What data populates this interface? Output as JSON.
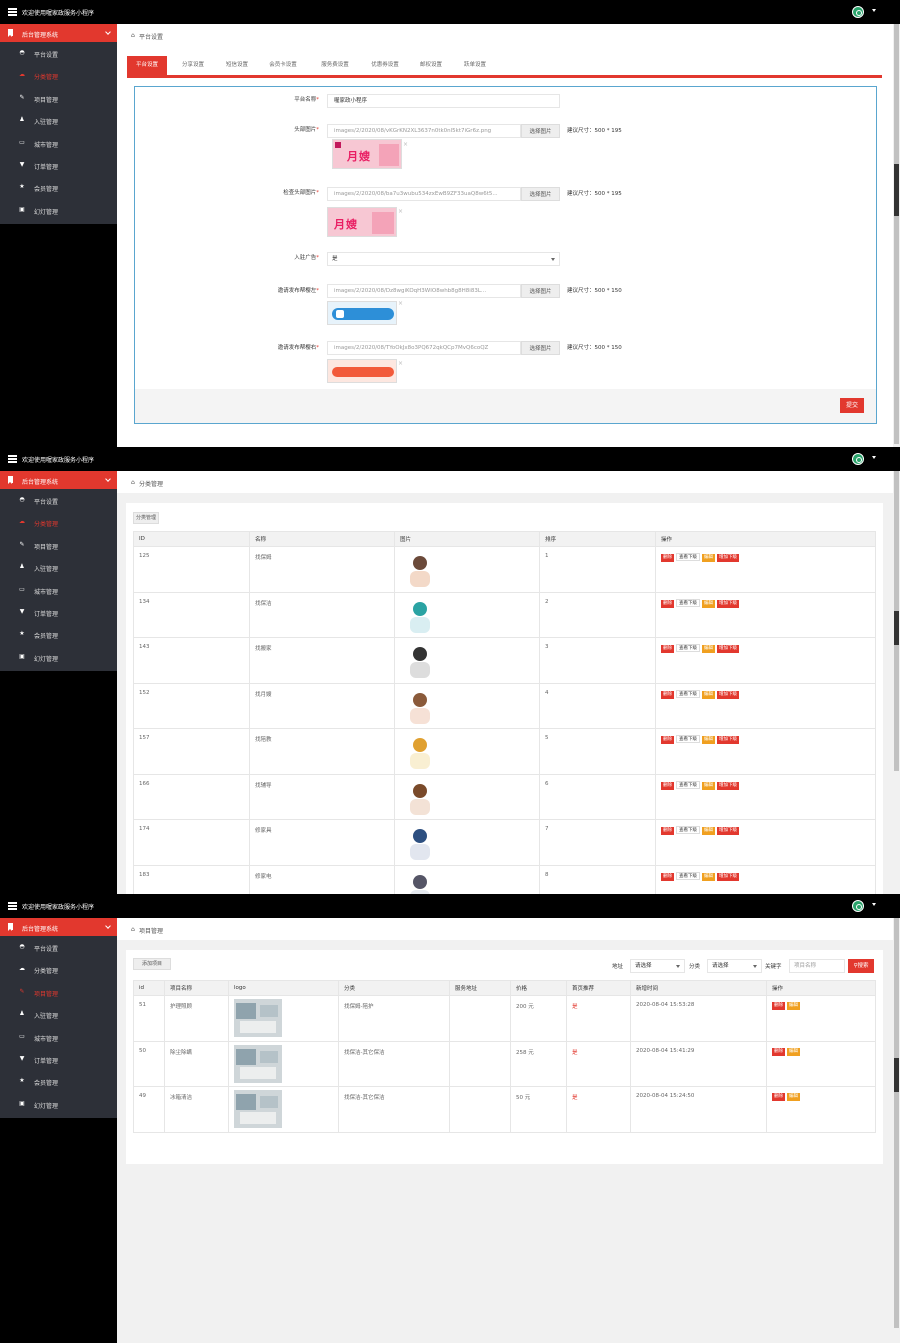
{
  "app": {
    "title": "欢迎使用喔家政服务小程序",
    "accent": "#e2382e",
    "sidebar_bg": "#2d3038"
  },
  "sidebar": {
    "head": "后台管理系统",
    "items": [
      {
        "label": "平台设置",
        "icon": "palette-icon"
      },
      {
        "label": "分类管理",
        "icon": "cloud-icon"
      },
      {
        "label": "项目管理",
        "icon": "pencil-icon"
      },
      {
        "label": "入驻管理",
        "icon": "user-icon"
      },
      {
        "label": "城市管理",
        "icon": "inbox-icon"
      },
      {
        "label": "订单管理",
        "icon": "filter-icon"
      },
      {
        "label": "会员管理",
        "icon": "star-icon"
      },
      {
        "label": "幻灯管理",
        "icon": "book-icon"
      }
    ]
  },
  "screen1": {
    "crumb": "平台设置",
    "tabs": [
      "平台设置",
      "分享设置",
      "短信设置",
      "会员卡设置",
      "服务费设置",
      "优惠券设置",
      "邮权设置",
      "跃单设置"
    ],
    "form": {
      "name_label": "平台名称",
      "name_value": "喔家政小程序",
      "head_label": "头部图片",
      "head_value": "images/2/2020/08/vKGrKN2XL3637n0tk0nl5kt7iGr6z.png",
      "banner_label": "检查头部图片",
      "banner_value": "images/2/2020/08/ba7u3wubu534zxEwB9ZF33uaQ8w6t5...",
      "ad_label": "入驻广告",
      "ad_value": "是",
      "left_label": "邀请发布帮樱左",
      "left_value": "images/2/2020/08/Dz8wgiKOqH3WIO8whb8g8H8i83L...",
      "right_label": "邀请发布帮樱右",
      "right_value": "images/2/2020/08/TYoOkJx8o3PQ672qkQCp7MvQ6coQZ",
      "pick_label": "选择图片",
      "hint1": "建议尺寸：500 * 195",
      "hint2": "建议尺寸：500 * 195",
      "hint3": "建议尺寸：500 * 150",
      "hint4": "建议尺寸：500 * 150",
      "submit": "提交",
      "close": "×"
    }
  },
  "screen2": {
    "crumb": "分类管理",
    "add_btn": "分类管理",
    "headers": [
      "ID",
      "名称",
      "图片",
      "排序",
      "操作"
    ],
    "ops": {
      "del": "删除",
      "sub": "查看下级",
      "edit": "编辑",
      "add": "增加下级"
    },
    "rows": [
      {
        "id": "125",
        "name": "找保姆",
        "sort": "1"
      },
      {
        "id": "134",
        "name": "找保洁",
        "sort": "2"
      },
      {
        "id": "143",
        "name": "找搬家",
        "sort": "3"
      },
      {
        "id": "152",
        "name": "找月嫂",
        "sort": "4"
      },
      {
        "id": "157",
        "name": "找陪教",
        "sort": "5"
      },
      {
        "id": "166",
        "name": "找辅导",
        "sort": "6"
      },
      {
        "id": "174",
        "name": "修家具",
        "sort": "7"
      },
      {
        "id": "183",
        "name": "修家电",
        "sort": "8"
      }
    ]
  },
  "screen3": {
    "crumb": "项目管理",
    "add_btn": "添加项目",
    "filter": {
      "city_label": "地址",
      "city_value": "请选择",
      "cat_label": "分类",
      "cat_value": "请选择",
      "kw_label": "关键字",
      "kw_placeholder": "项目名称",
      "search": "搜索"
    },
    "headers": [
      "id",
      "项目名称",
      "logo",
      "分类",
      "服务地址",
      "价格",
      "首页推荐",
      "新增时间",
      "操作"
    ],
    "ops": {
      "del": "删除",
      "edit": "编辑"
    },
    "rows": [
      {
        "id": "51",
        "name": "护理照顾",
        "cat": "找保姆-陪护",
        "addr": "",
        "price": "200 元",
        "rec": "是",
        "time": "2020-08-04 15:53:28"
      },
      {
        "id": "50",
        "name": "除尘除螨",
        "cat": "找保洁-其它保洁",
        "addr": "",
        "price": "258 元",
        "rec": "是",
        "time": "2020-08-04 15:41:29"
      },
      {
        "id": "49",
        "name": "冰箱清洁",
        "cat": "找保洁-其它保洁",
        "addr": "",
        "price": "50 元",
        "rec": "是",
        "time": "2020-08-04 15:24:50"
      }
    ]
  }
}
